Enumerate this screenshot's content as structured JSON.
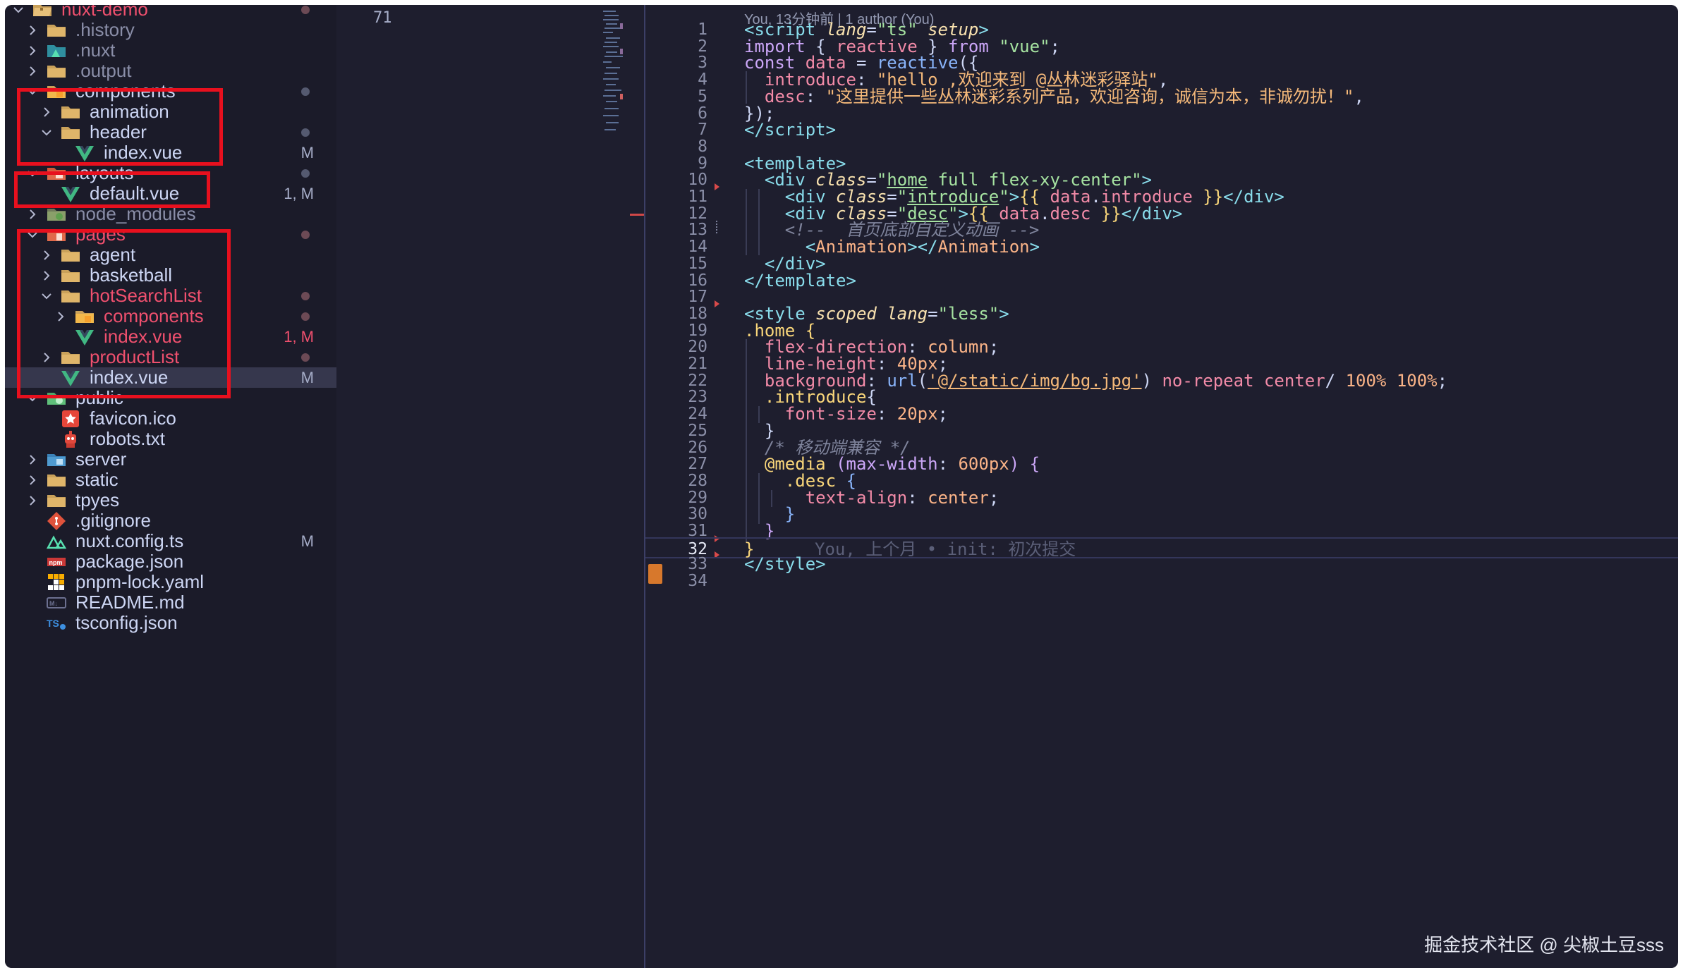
{
  "explorer": {
    "items": [
      {
        "label": "nuxt-demo",
        "chevron": "down",
        "icon": "folder-root-icon",
        "color": "red"
      },
      {
        "label": ".history",
        "chevron": "right",
        "icon": "folder-icon",
        "color": "dim"
      },
      {
        "label": ".nuxt",
        "chevron": "right",
        "icon": "nuxt-folder-icon",
        "color": "dim"
      },
      {
        "label": ".output",
        "chevron": "right",
        "icon": "folder-icon",
        "color": "dim"
      },
      {
        "label": "components",
        "chevron": "down",
        "icon": "components-folder-icon"
      },
      {
        "label": "animation",
        "chevron": "right",
        "icon": "folder-icon"
      },
      {
        "label": "header",
        "chevron": "down",
        "icon": "folder-icon"
      },
      {
        "label": "index.vue",
        "icon": "vue-file-icon",
        "status": "M"
      },
      {
        "label": "layouts",
        "chevron": "down",
        "icon": "layouts-folder-icon"
      },
      {
        "label": "default.vue",
        "icon": "vue-file-icon",
        "status": "1, M"
      },
      {
        "label": "node_modules",
        "chevron": "right",
        "icon": "node-modules-folder-icon",
        "color": "dim"
      },
      {
        "label": "pages",
        "chevron": "down",
        "icon": "pages-folder-icon",
        "color": "red"
      },
      {
        "label": "agent",
        "chevron": "right",
        "icon": "folder-icon"
      },
      {
        "label": "basketball",
        "chevron": "right",
        "icon": "folder-icon"
      },
      {
        "label": "hotSearchList",
        "chevron": "down",
        "icon": "folder-icon",
        "color": "red"
      },
      {
        "label": "components",
        "chevron": "right",
        "icon": "components-folder-icon",
        "color": "red"
      },
      {
        "label": "index.vue",
        "icon": "vue-file-icon",
        "status": "1, M",
        "color": "red"
      },
      {
        "label": "productList",
        "chevron": "right",
        "icon": "folder-icon",
        "color": "red"
      },
      {
        "label": "index.vue",
        "icon": "vue-file-icon",
        "status": "M"
      },
      {
        "label": "public",
        "chevron": "down",
        "icon": "public-folder-icon"
      },
      {
        "label": "favicon.ico",
        "icon": "star-icon"
      },
      {
        "label": "robots.txt",
        "icon": "robot-icon"
      },
      {
        "label": "server",
        "chevron": "right",
        "icon": "server-folder-icon"
      },
      {
        "label": "static",
        "chevron": "right",
        "icon": "folder-icon"
      },
      {
        "label": "tpyes",
        "chevron": "right",
        "icon": "folder-icon"
      },
      {
        "label": ".gitignore",
        "icon": "git-icon"
      },
      {
        "label": "nuxt.config.ts",
        "icon": "nuxt-icon",
        "status": "M"
      },
      {
        "label": "package.json",
        "icon": "npm-icon"
      },
      {
        "label": "pnpm-lock.yaml",
        "icon": "pnpm-icon"
      },
      {
        "label": "README.md",
        "icon": "markdown-icon"
      },
      {
        "label": "tsconfig.json",
        "icon": "tsconfig-icon"
      }
    ]
  },
  "left_pane": {
    "line_number": "71"
  },
  "editor": {
    "blame_header": "You, 13分钟前 | 1 author (You)",
    "inline_blame": "You, 上个月 • init: 初次提交",
    "current_line": 32,
    "line_numbers": [
      "1",
      "2",
      "3",
      "4",
      "5",
      "6",
      "7",
      "8",
      "9",
      "10",
      "11",
      "12",
      "13",
      "14",
      "15",
      "16",
      "17",
      "18",
      "19",
      "20",
      "21",
      "22",
      "23",
      "24",
      "25",
      "26",
      "27",
      "28",
      "29",
      "30",
      "31",
      "32",
      "33",
      "34"
    ]
  },
  "colors": {
    "highlight_box": "#e8101e",
    "background": "#1e1e2e",
    "sidebar": "#1b1b29"
  },
  "watermark": "掘金技术社区 @ 尖椒土豆sss"
}
